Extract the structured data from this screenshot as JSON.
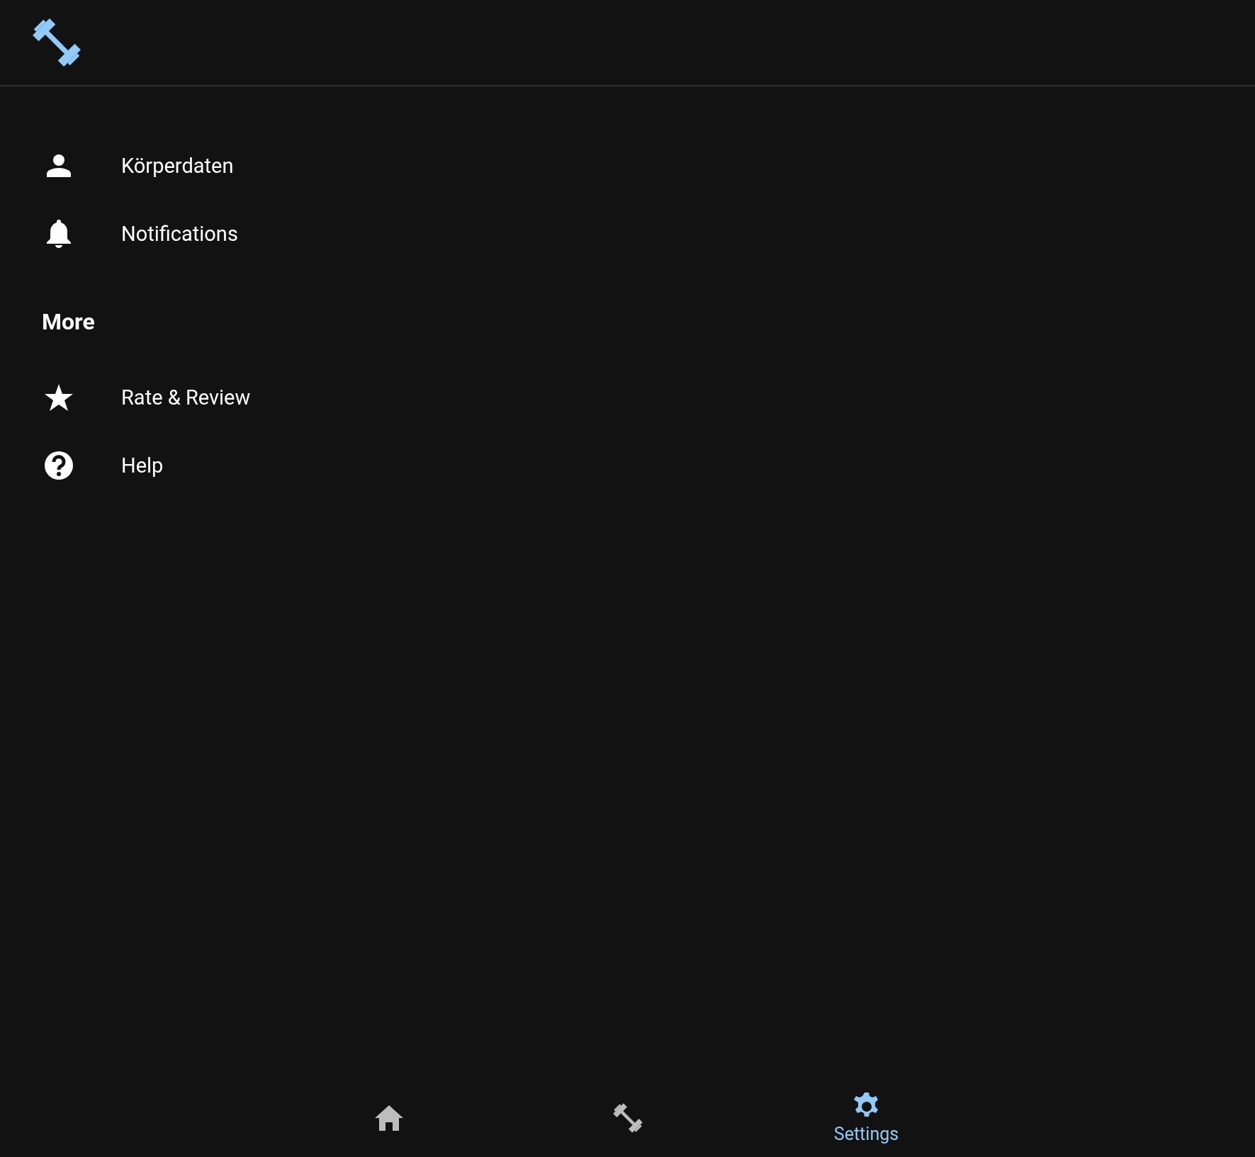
{
  "sections": [
    {
      "items": [
        {
          "kind": "person",
          "label": "Körperdaten"
        },
        {
          "kind": "bell",
          "label": "Notifications"
        }
      ]
    },
    {
      "title": "More",
      "items": [
        {
          "kind": "star",
          "label": "Rate & Review"
        },
        {
          "kind": "help",
          "label": "Help"
        }
      ]
    }
  ],
  "bottom_nav": [
    {
      "kind": "home",
      "selected": false
    },
    {
      "kind": "dumbbell",
      "selected": false
    },
    {
      "kind": "gear",
      "label": "Settings",
      "selected": true
    }
  ]
}
